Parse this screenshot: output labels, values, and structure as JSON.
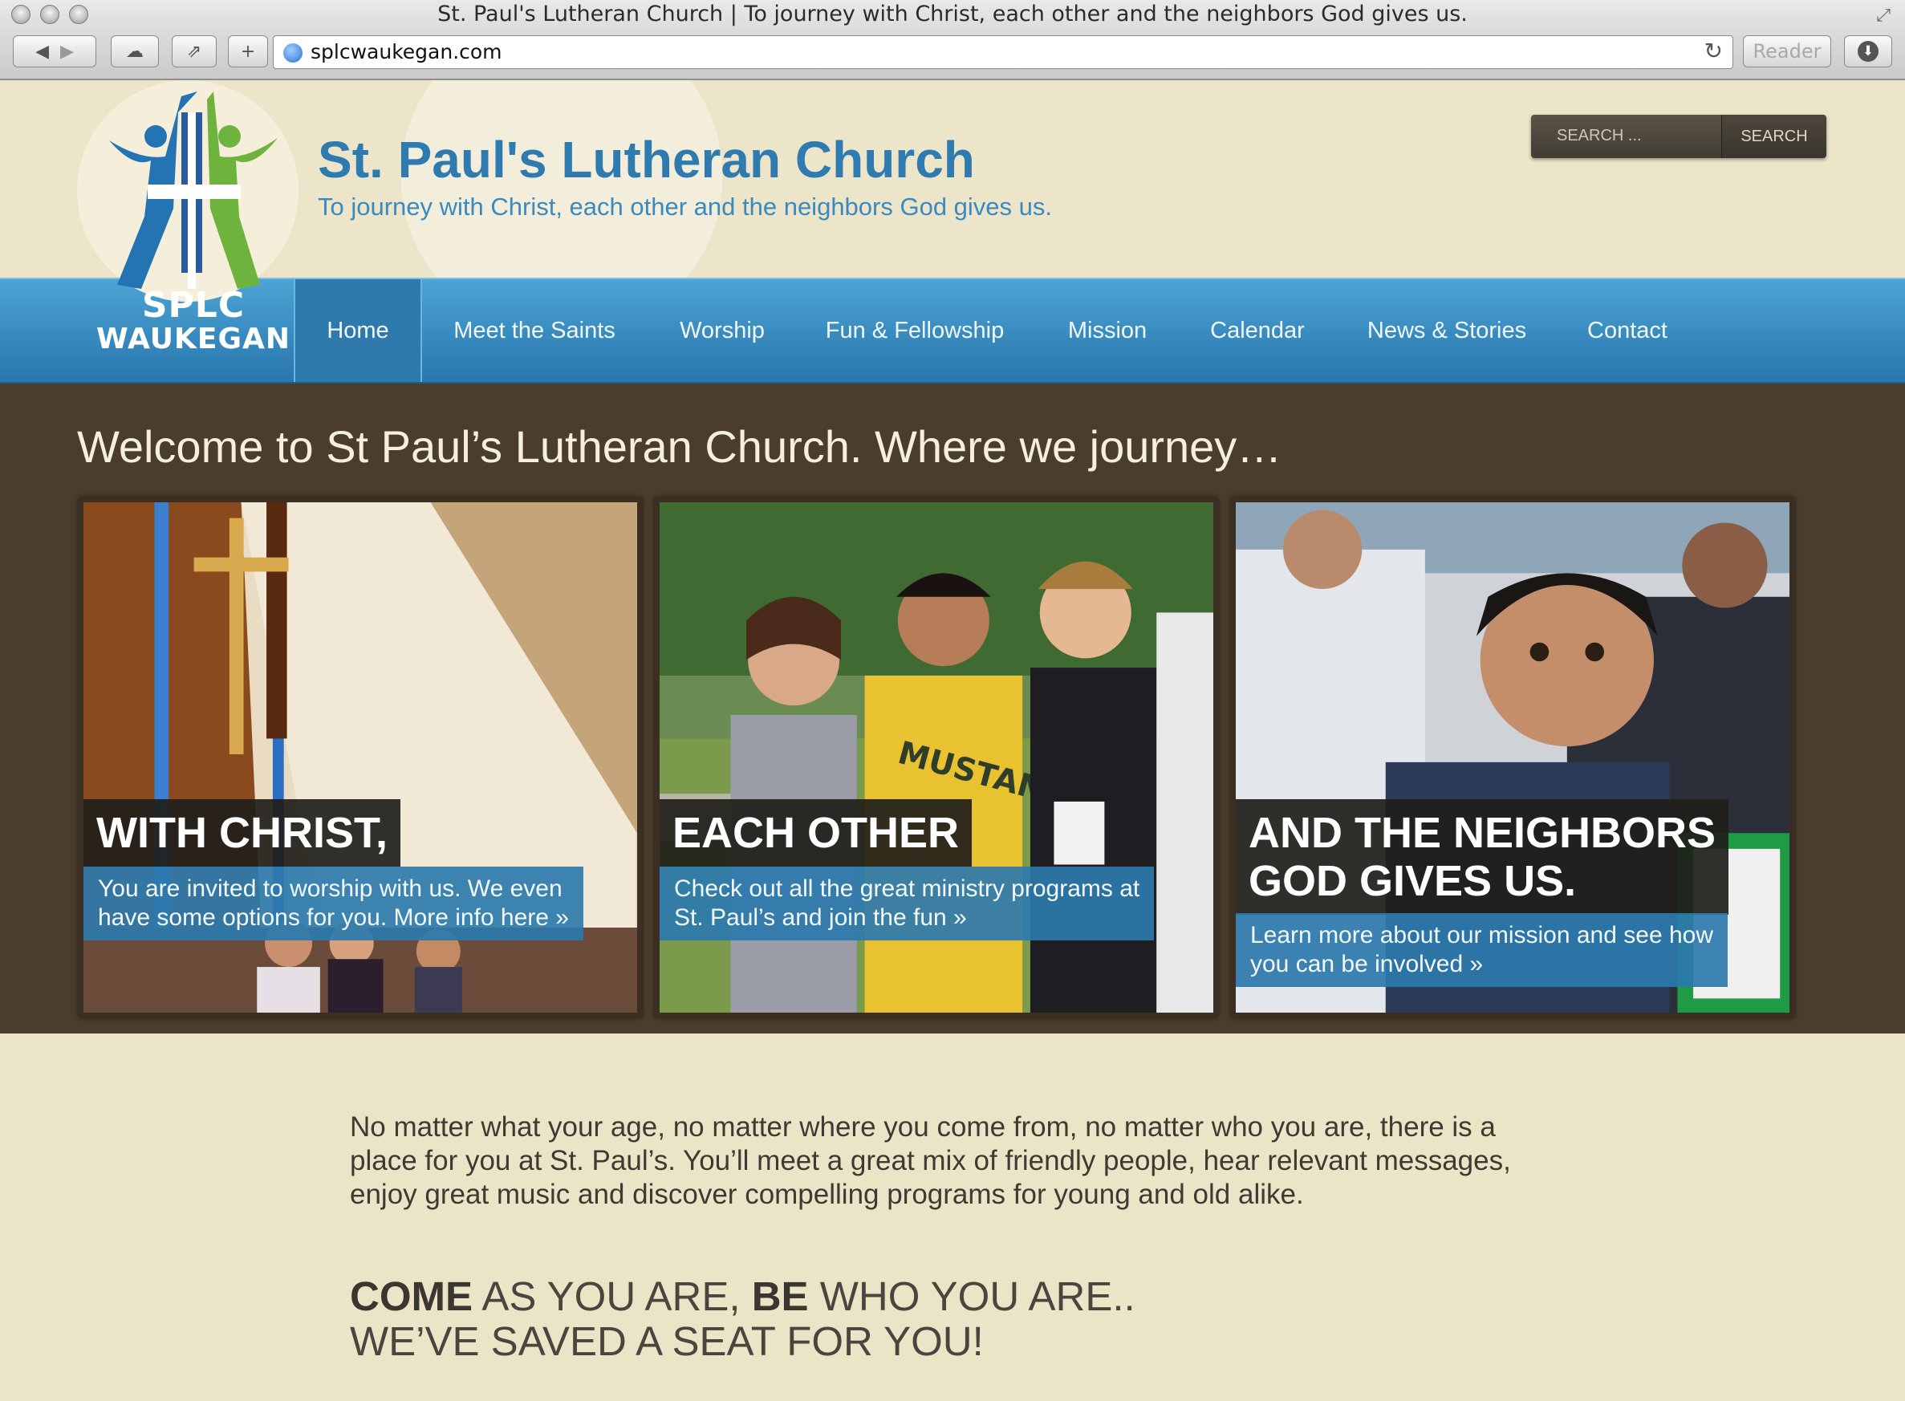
{
  "browser": {
    "window_title": "St. Paul's Lutheran Church | To journey with Christ, each other and the neighbors God gives us.",
    "url": "splcwaukegan.com",
    "reader_label": "Reader"
  },
  "header": {
    "site_title": "St. Paul's Lutheran Church",
    "tagline": "To journey with Christ, each other and the neighbors God gives us.",
    "logo_line1": "SPLC",
    "logo_line2": "WAUKEGAN",
    "search_placeholder": "SEARCH ...",
    "search_button": "SEARCH"
  },
  "nav": {
    "items": [
      {
        "label": "Home"
      },
      {
        "label": "Meet the Saints"
      },
      {
        "label": "Worship"
      },
      {
        "label": "Fun & Fellowship"
      },
      {
        "label": "Mission"
      },
      {
        "label": "Calendar"
      },
      {
        "label": "News & Stories"
      },
      {
        "label": "Contact"
      }
    ],
    "active": "Home"
  },
  "main": {
    "welcome": "Welcome to St Paul’s Lutheran Church. Where we journey…",
    "tiles": [
      {
        "heading": "WITH CHRIST,",
        "text_line1": "You are invited to worship with us. We even",
        "text_line2": "have some options for you. More info here »"
      },
      {
        "heading": "EACH OTHER",
        "text_line1": "Check out all the great ministry programs at",
        "text_line2": "St. Paul’s and join the fun »"
      },
      {
        "heading_line1": "AND THE NEIGHBORS",
        "heading_line2": "GOD GIVES US.",
        "text_line1": "Learn more about our mission and see how",
        "text_line2": "you can be involved »"
      }
    ],
    "intro_line1": "No matter what your age, no matter where you come from, no matter who you are, there is a",
    "intro_line2": "place for you at St. Paul’s. You’ll meet a great mix of friendly people, hear relevant messages,",
    "intro_line3": "enjoy great music and discover compelling programs for young and old alike.",
    "slogan": {
      "w1": "COME",
      "w2": " AS YOU ARE, ",
      "w3": "BE",
      "w4": " WHO YOU ARE..",
      "line2": "WE’VE SAVED A SEAT FOR YOU!"
    }
  },
  "colors": {
    "brand_blue": "#2f7bb0",
    "nav_blue": "#3a8dc4",
    "band_brown": "#4a3d2d",
    "cream": "#ece4c7",
    "logo_green": "#6fb33f"
  }
}
